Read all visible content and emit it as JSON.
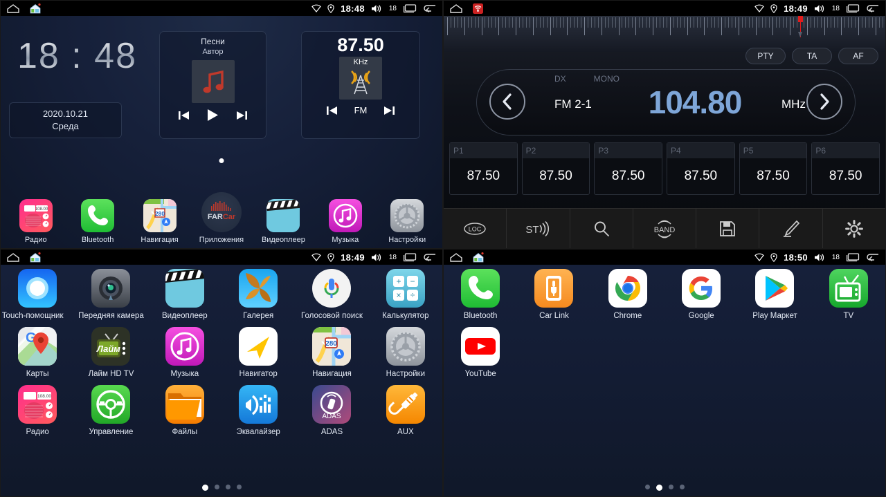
{
  "statusbar": {
    "time_p1": "18:48",
    "time_p2": "18:49",
    "time_p3": "18:49",
    "time_p4": "18:50",
    "volume": "18",
    "icons": [
      "wifi-icon",
      "location-icon",
      "volume-icon",
      "recents-icon",
      "back-icon"
    ]
  },
  "home": {
    "clock": "18 : 48",
    "date": "2020.10.21",
    "weekday": "Среда",
    "music_widget": {
      "title": "Песни",
      "artist": "Автор",
      "prev": "prev-icon",
      "play": "play-icon",
      "next": "next-icon"
    },
    "radio_widget": {
      "frequency": "87.50",
      "unit": "KHz",
      "band": "FM"
    },
    "dock": [
      {
        "label": "Радио",
        "icon": "radio-icon"
      },
      {
        "label": "Bluetooth",
        "icon": "phone-icon"
      },
      {
        "label": "Навигация",
        "icon": "maps-icon"
      },
      {
        "label": "Приложения",
        "icon": "farcar-icon"
      },
      {
        "label": "Видеоплеер",
        "icon": "video-icon"
      },
      {
        "label": "Музыка",
        "icon": "music-icon"
      },
      {
        "label": "Настройки",
        "icon": "settings-icon"
      }
    ]
  },
  "radio": {
    "rds_buttons": [
      "PTY",
      "TA",
      "AF"
    ],
    "dx": "DX",
    "mono": "MONO",
    "band_label": "FM 2-1",
    "frequency": "104.80",
    "unit": "MHz",
    "prev_arrow": "chevron-left-icon",
    "next_arrow": "chevron-right-icon",
    "presets": [
      {
        "slot": "P1",
        "value": "87.50"
      },
      {
        "slot": "P2",
        "value": "87.50"
      },
      {
        "slot": "P3",
        "value": "87.50"
      },
      {
        "slot": "P4",
        "value": "87.50"
      },
      {
        "slot": "P5",
        "value": "87.50"
      },
      {
        "slot": "P6",
        "value": "87.50"
      }
    ],
    "toolbar": [
      {
        "label": "LOC",
        "icon": "loc-icon"
      },
      {
        "label": "ST",
        "icon": "stereo-icon"
      },
      {
        "label": "",
        "icon": "search-icon"
      },
      {
        "label": "BAND",
        "icon": "band-icon"
      },
      {
        "label": "",
        "icon": "save-icon"
      },
      {
        "label": "",
        "icon": "edit-icon"
      },
      {
        "label": "",
        "icon": "gear-icon"
      }
    ]
  },
  "app_drawer": {
    "apps": [
      {
        "label": "Touch-помощник",
        "icon": "touch-assistant-icon"
      },
      {
        "label": "Передняя камера",
        "icon": "camera-icon"
      },
      {
        "label": "Видеоплеер",
        "icon": "video-icon"
      },
      {
        "label": "Галерея",
        "icon": "gallery-icon"
      },
      {
        "label": "Голосовой поиск",
        "icon": "voice-search-icon"
      },
      {
        "label": "Калькулятор",
        "icon": "calculator-icon"
      },
      {
        "label": "Карты",
        "icon": "google-maps-icon"
      },
      {
        "label": "Лайм HD TV",
        "icon": "lime-tv-icon"
      },
      {
        "label": "Музыка",
        "icon": "music-icon"
      },
      {
        "label": "Навигатор",
        "icon": "navigator-icon"
      },
      {
        "label": "Навигация",
        "icon": "maps-icon"
      },
      {
        "label": "Настройки",
        "icon": "settings-icon"
      },
      {
        "label": "Радио",
        "icon": "radio-icon"
      },
      {
        "label": "Управление",
        "icon": "steering-wheel-icon"
      },
      {
        "label": "Файлы",
        "icon": "files-icon"
      },
      {
        "label": "Эквалайзер",
        "icon": "equalizer-icon"
      },
      {
        "label": "ADAS",
        "icon": "adas-icon"
      },
      {
        "label": "AUX",
        "icon": "aux-icon"
      }
    ],
    "page_count": 4,
    "active_page": 1
  },
  "app_drawer_page2": {
    "apps": [
      {
        "label": "Bluetooth",
        "icon": "phone-icon"
      },
      {
        "label": "Car Link",
        "icon": "car-link-icon"
      },
      {
        "label": "Chrome",
        "icon": "chrome-icon"
      },
      {
        "label": "Google",
        "icon": "google-icon"
      },
      {
        "label": "Play Маркет",
        "icon": "play-store-icon"
      },
      {
        "label": "TV",
        "icon": "tv-icon"
      },
      {
        "label": "YouTube",
        "icon": "youtube-icon"
      }
    ],
    "page_count": 4,
    "active_page": 2
  },
  "colors": {
    "accent_blue": "#7ea6d8",
    "needle_red": "#e21b1b",
    "bg_dark": "#101829"
  }
}
